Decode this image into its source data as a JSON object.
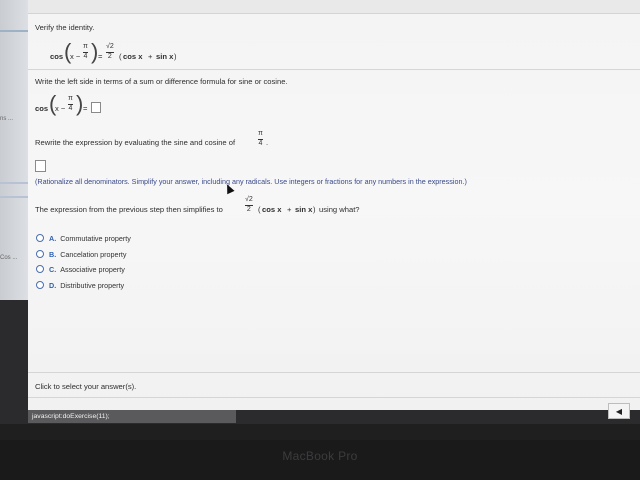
{
  "sidebar": {
    "fragment_1": "ns ...",
    "fragment_2": "Cos ..."
  },
  "problem": {
    "heading": "Verify the identity.",
    "identity": {
      "lhs_func": "cos",
      "lhs_arg_prefix": "x −",
      "lhs_frac_num": "π",
      "lhs_frac_den": "4",
      "equals": "=",
      "rhs_frac_num": "√2",
      "rhs_frac_den": "2",
      "rhs_open": "(",
      "rhs_cos": "cos x",
      "rhs_plus": "+",
      "rhs_sin": "sin x",
      "rhs_close": ")"
    }
  },
  "step1": {
    "instruction": "Write the left side in terms of a sum or difference formula for sine or cosine.",
    "func": "cos",
    "arg_prefix": "x −",
    "frac_num": "π",
    "frac_den": "4",
    "equals": "="
  },
  "step2": {
    "instruction": "Rewrite the expression by evaluating the sine and cosine of",
    "frac_num": "π",
    "frac_den": "4",
    "period": ".",
    "hint": "(Rationalize all denominators. Simplify your answer, including any radicals. Use integers or fractions for any numbers in the expression.)"
  },
  "step3": {
    "question_prefix": "The expression from the previous step then simplifies to",
    "frac_num": "√2",
    "frac_den": "2",
    "expr_open": "(",
    "expr_cos": "cos x",
    "expr_plus": "+",
    "expr_sin": "sin x",
    "expr_close": ")",
    "question_suffix": "using what?",
    "options": [
      {
        "letter": "A.",
        "text": "Commutative property"
      },
      {
        "letter": "B.",
        "text": "Cancelation property"
      },
      {
        "letter": "C.",
        "text": "Associative property"
      },
      {
        "letter": "D.",
        "text": "Distributive property"
      }
    ]
  },
  "footer": {
    "prompt": "Click to select your answer(s)."
  },
  "status_bar": {
    "text": "javascript:doExercise(11);"
  },
  "nav": {
    "arrow_glyph": "◀"
  },
  "bezel": {
    "brand": "MacBook Pro"
  }
}
